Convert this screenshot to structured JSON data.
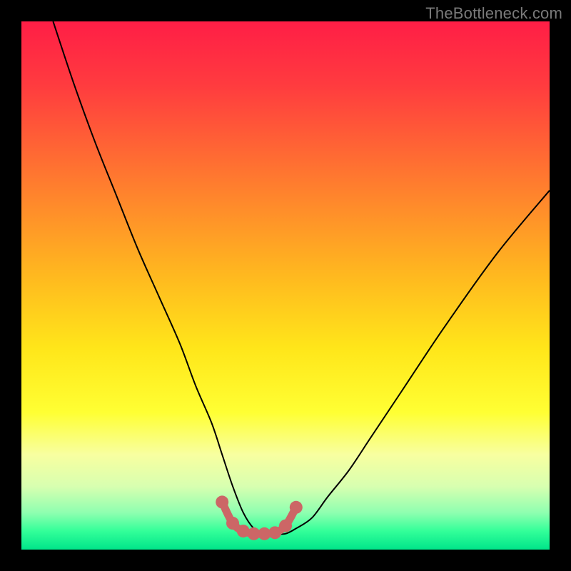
{
  "watermark": {
    "text": "TheBottleneck.com"
  },
  "chart_data": {
    "type": "line",
    "title": "",
    "xlabel": "",
    "ylabel": "",
    "xlim": [
      0,
      100
    ],
    "ylim": [
      0,
      100
    ],
    "grid": false,
    "legend": false,
    "gradient_stops": [
      {
        "offset": 0.0,
        "color": "#ff1e46"
      },
      {
        "offset": 0.12,
        "color": "#ff3b3f"
      },
      {
        "offset": 0.3,
        "color": "#ff7a2f"
      },
      {
        "offset": 0.48,
        "color": "#ffb81f"
      },
      {
        "offset": 0.62,
        "color": "#ffe61a"
      },
      {
        "offset": 0.74,
        "color": "#ffff33"
      },
      {
        "offset": 0.82,
        "color": "#f8ffa0"
      },
      {
        "offset": 0.88,
        "color": "#d8ffb0"
      },
      {
        "offset": 0.93,
        "color": "#8fffb0"
      },
      {
        "offset": 0.965,
        "color": "#33ff99"
      },
      {
        "offset": 1.0,
        "color": "#00e58a"
      }
    ],
    "series": [
      {
        "name": "bottleneck-curve",
        "color": "#000000",
        "width": 2,
        "x": [
          6,
          10,
          14,
          18,
          22,
          26,
          30,
          33,
          36,
          38,
          40,
          42,
          44,
          46,
          48,
          50,
          52,
          55,
          58,
          62,
          66,
          72,
          80,
          90,
          100
        ],
        "y": [
          100,
          88,
          77,
          67,
          57,
          48,
          39,
          31,
          24,
          18,
          12,
          7,
          4,
          3,
          3,
          3,
          4,
          6,
          10,
          15,
          21,
          30,
          42,
          56,
          68
        ]
      },
      {
        "name": "optimal-band-markers",
        "color": "#cc6666",
        "marker_radius": 9,
        "stroke_width": 11,
        "x": [
          38,
          40,
          42,
          44,
          46,
          48,
          50,
          52
        ],
        "y": [
          9,
          5,
          3.5,
          3,
          3,
          3.2,
          4.5,
          8
        ]
      }
    ]
  }
}
